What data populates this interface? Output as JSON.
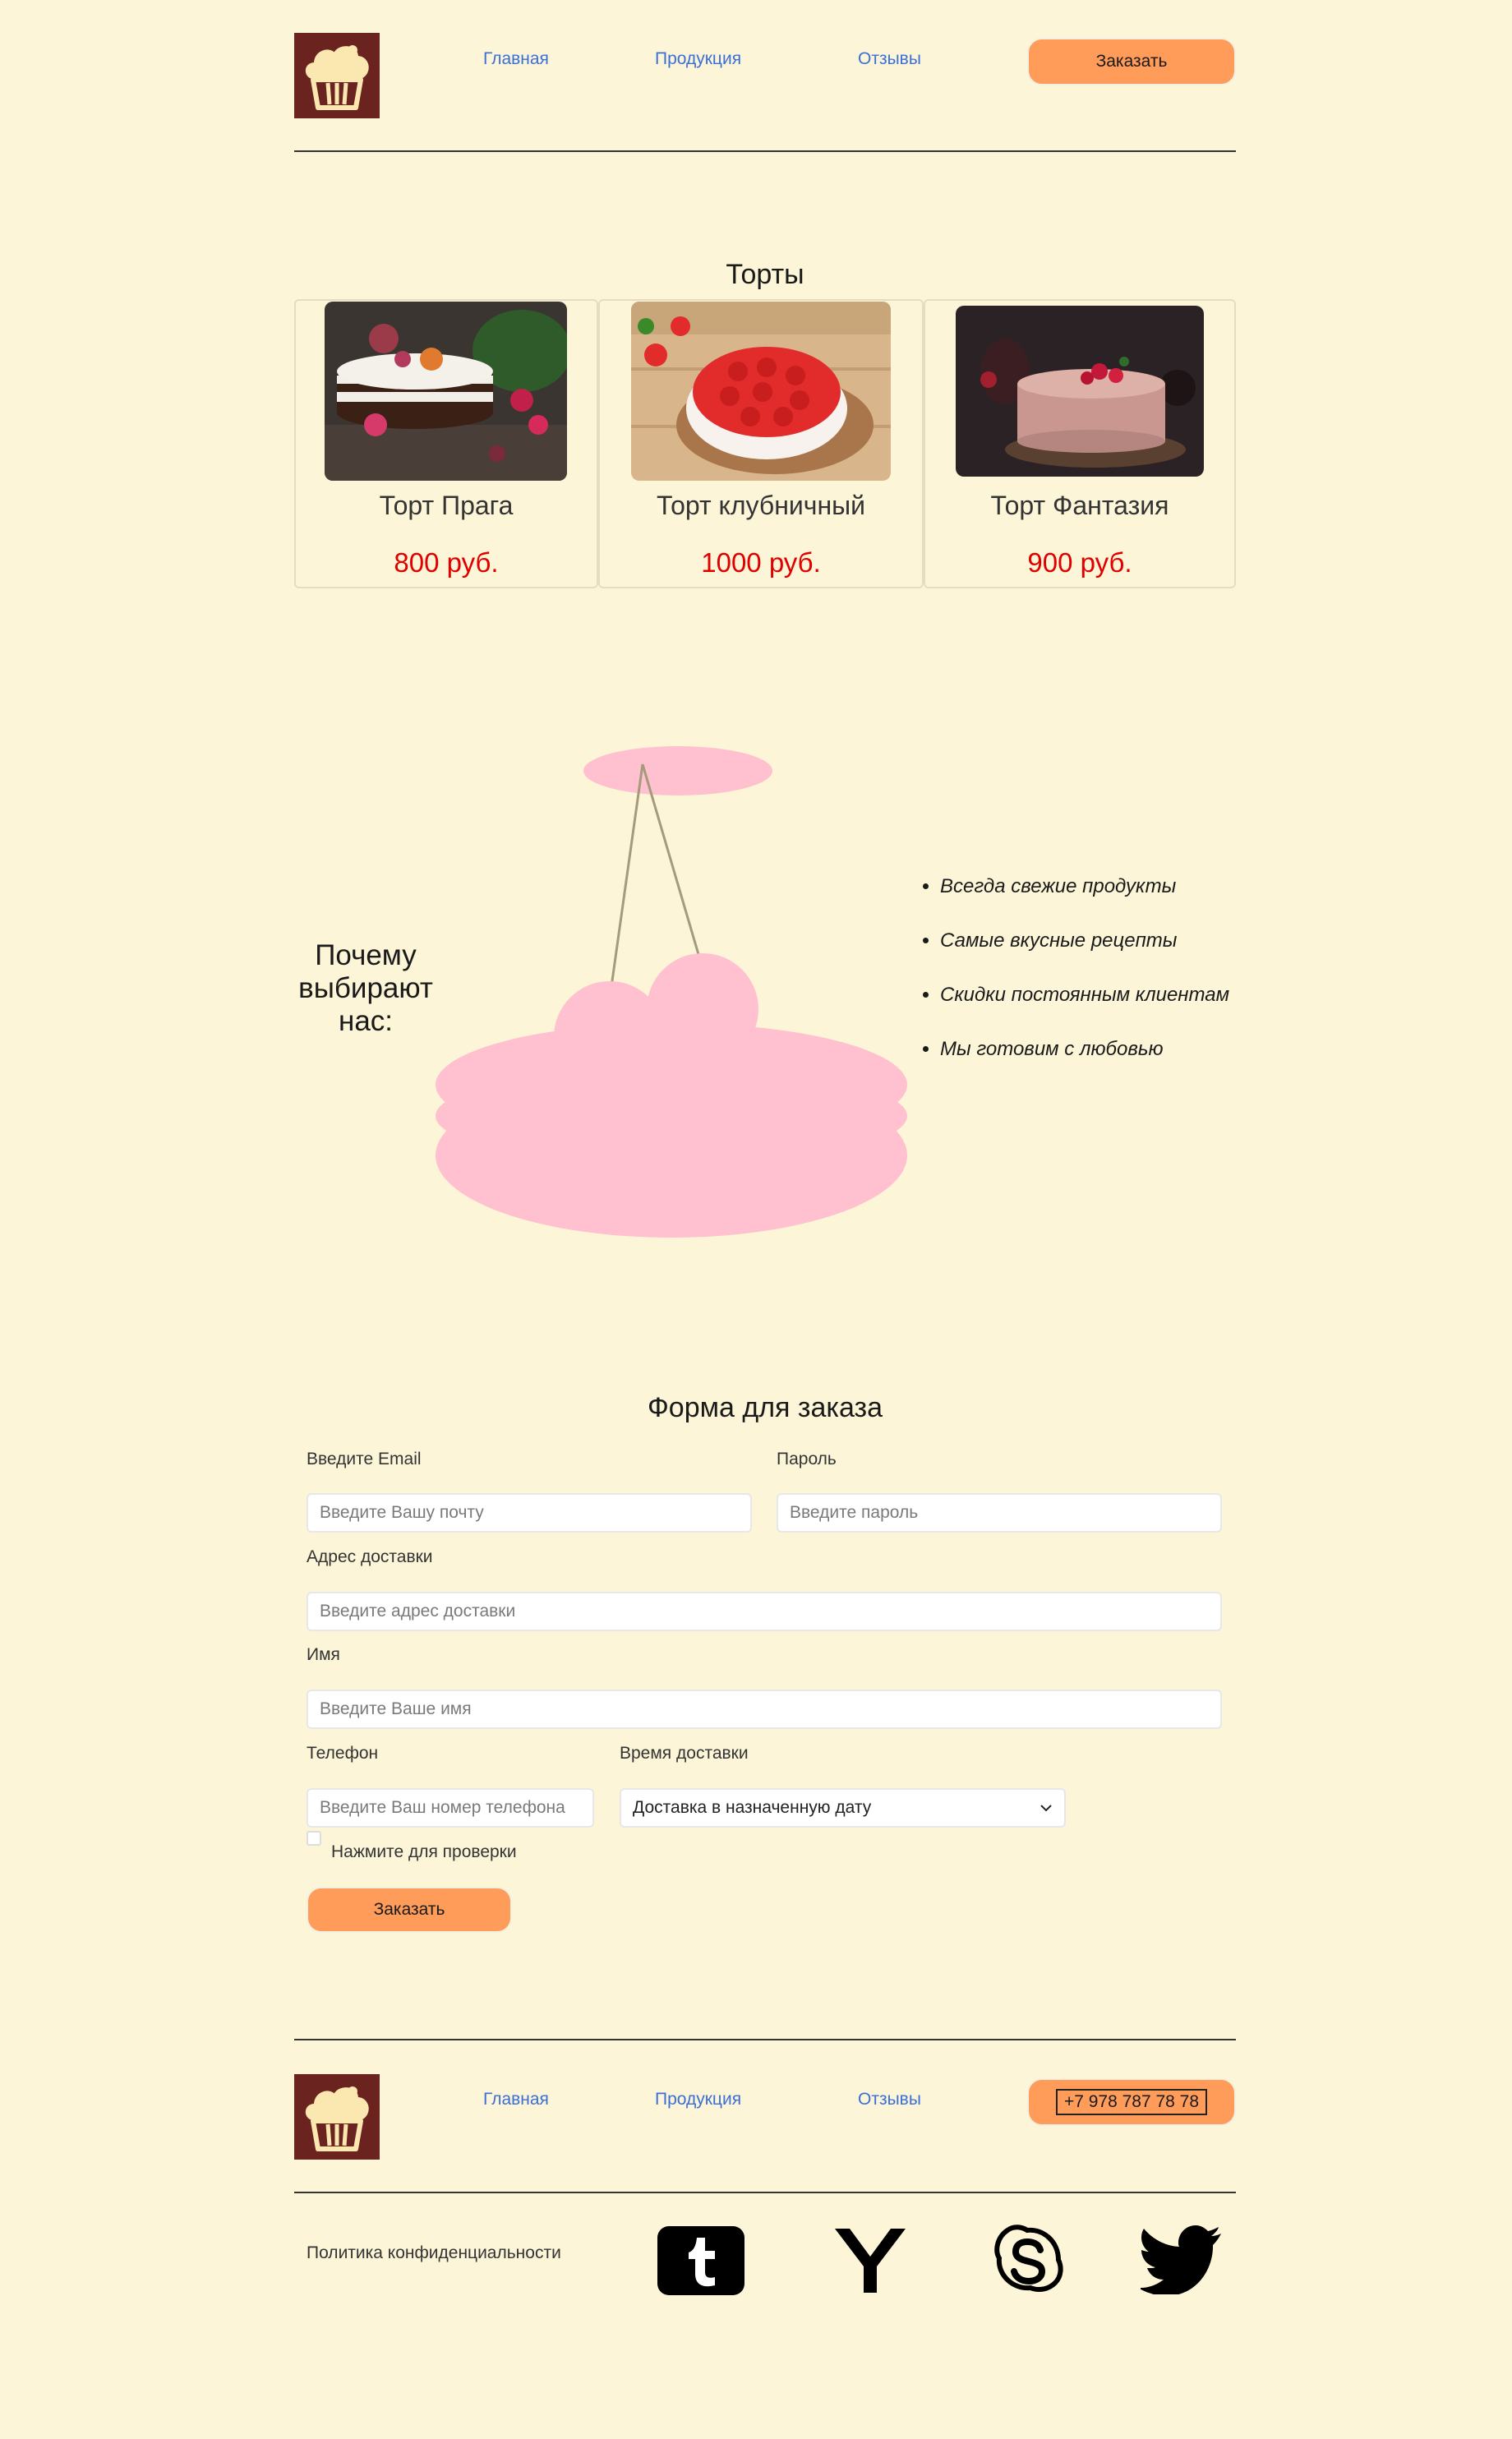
{
  "header": {
    "nav": [
      "Главная",
      "Продукция",
      "Отзывы"
    ],
    "order_label": "Заказать"
  },
  "cakes": {
    "title": "Торты",
    "items": [
      {
        "name": "Торт Прага",
        "price": "800 руб."
      },
      {
        "name": "Торт клубничный",
        "price": "1000 руб."
      },
      {
        "name": "Торт Фантазия",
        "price": "900 руб."
      }
    ]
  },
  "why": {
    "title": "Почему выбирают нас:",
    "points": [
      "Всегда свежие продукты",
      "Самые вкусные рецепты",
      "Скидки постоянным клиентам",
      "Мы готовим с любовью"
    ]
  },
  "form": {
    "title": "Форма для заказа",
    "email_label": "Введите Email",
    "email_placeholder": "Введите Вашу почту",
    "password_label": "Пароль",
    "password_placeholder": "Введите пароль",
    "address_label": "Адрес доставки",
    "address_placeholder": "Введите адрес доставки",
    "name_label": "Имя",
    "name_placeholder": "Введите Ваше имя",
    "phone_label": "Телефон",
    "phone_placeholder": "Введите Ваш номер телефона",
    "time_label": "Время доставки",
    "time_value": "Доставка в назначенную дату",
    "check_label": "Нажмите для проверки",
    "submit_label": "Заказать"
  },
  "footer": {
    "nav": [
      "Главная",
      "Продукция",
      "Отзывы"
    ],
    "phone": "+7 978 787 78 78",
    "privacy": "Политика конфиденциальности",
    "socials": [
      "tumblr-icon",
      "yandex-icon",
      "skype-icon",
      "twitter-icon"
    ]
  },
  "colors": {
    "background": "#fcf5d8",
    "accent": "#ff9c5a",
    "price": "#e00000",
    "link": "#3b6fd8",
    "logo_bg": "#6b2320",
    "cake_pink": "#ffc0d0"
  }
}
